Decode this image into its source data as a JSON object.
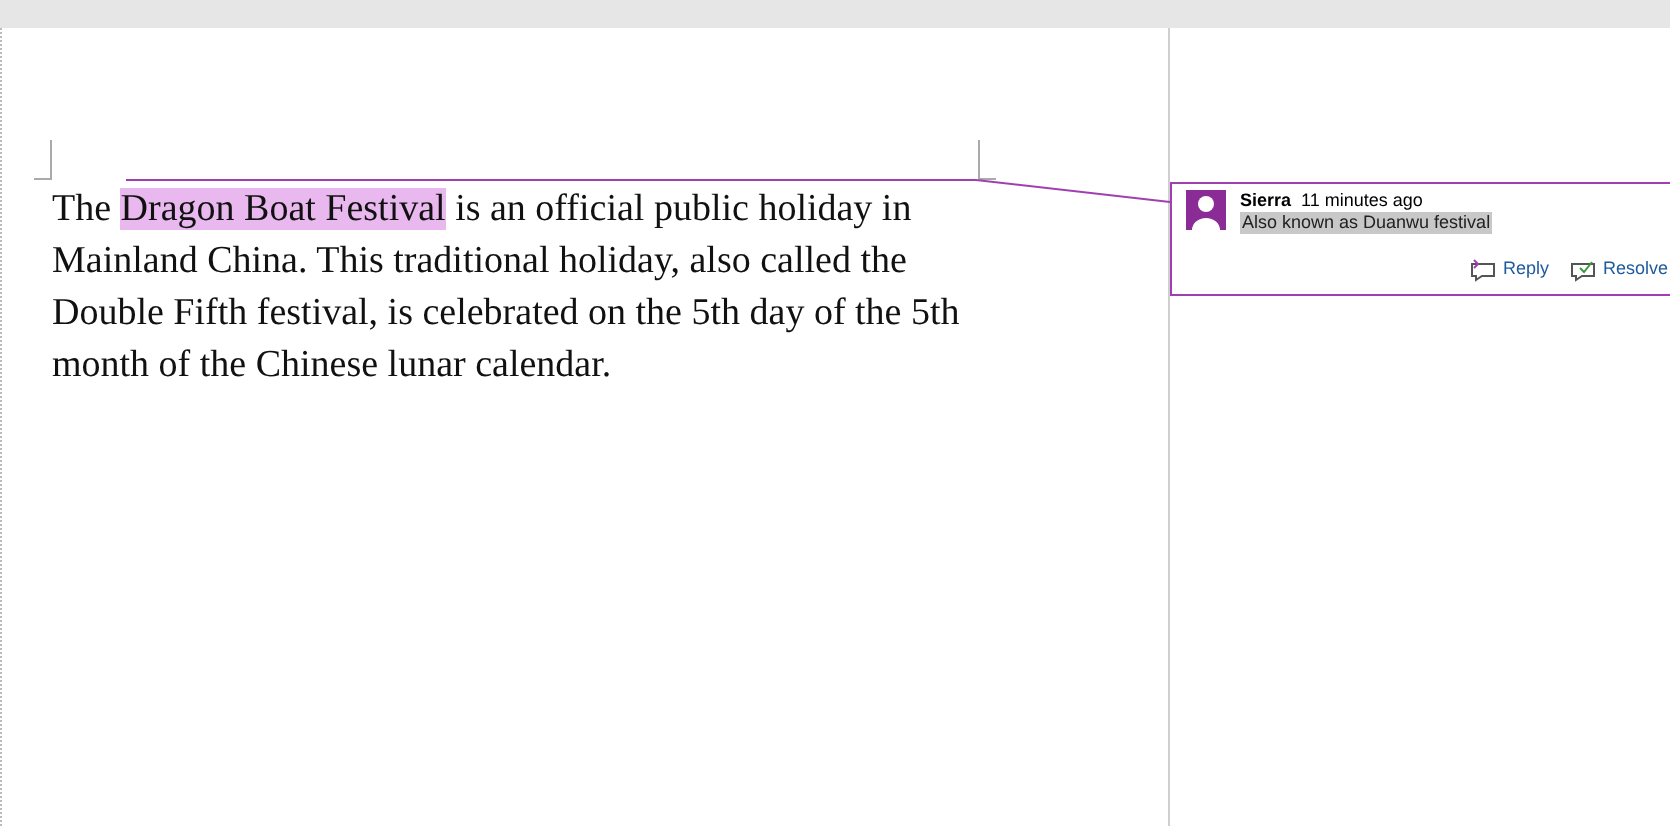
{
  "document": {
    "before": "The ",
    "highlight": "Dragon Boat Festival",
    "after": " is an official public holiday in Mainland China. This traditional holiday, also called the Double Fifth festival, is celebrated on the 5th day of the 5th month of the Chinese lunar calendar."
  },
  "comment": {
    "author": "Sierra",
    "time": "11 minutes ago",
    "text": "Also known as Duanwu festival",
    "actions": [
      {
        "kind": "reply",
        "label": "Reply"
      },
      {
        "kind": "resolve",
        "label": "Resolve"
      }
    ]
  }
}
